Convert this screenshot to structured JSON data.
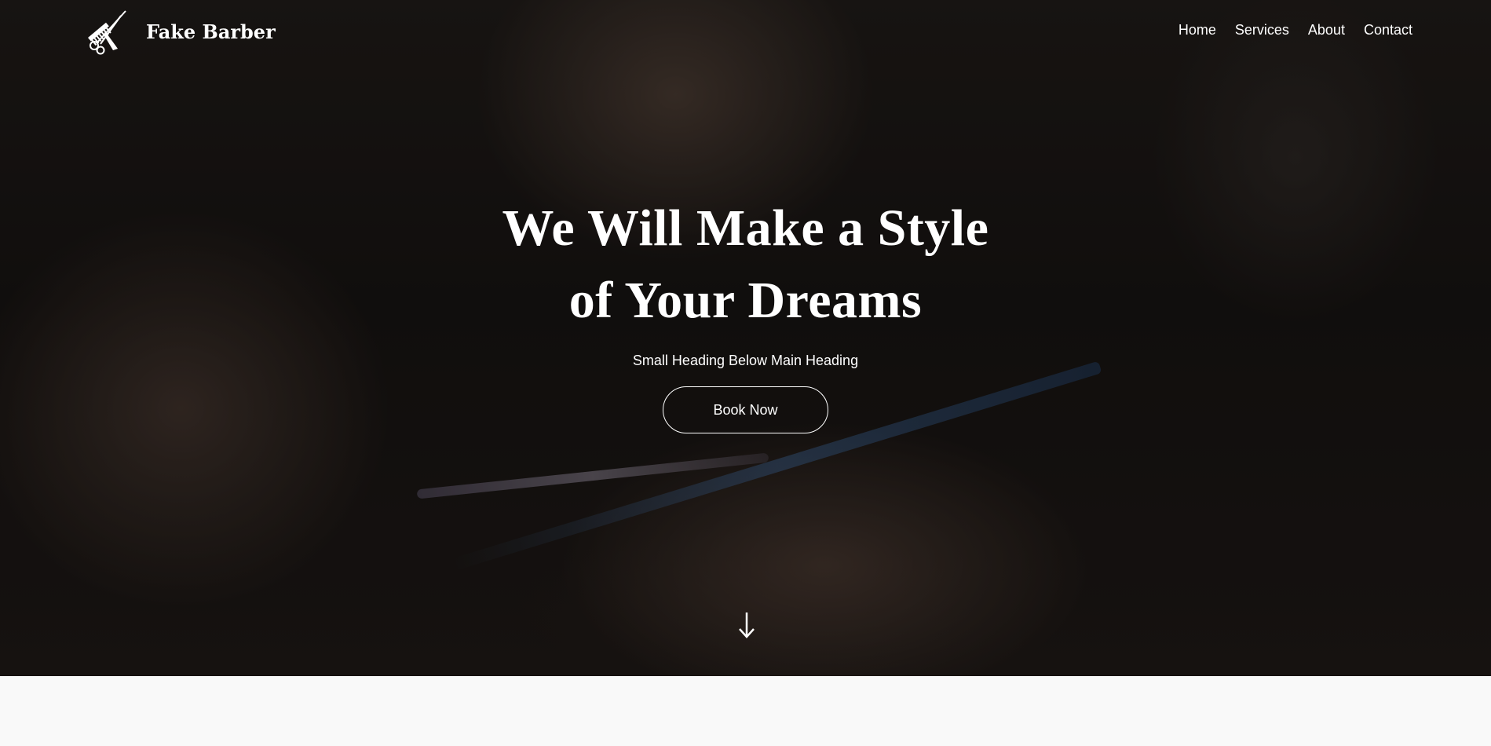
{
  "brand": {
    "name": "Fake Barber",
    "logo_icon": "comb-scissors-icon"
  },
  "nav": {
    "items": [
      "Home",
      "Services",
      "About",
      "Contact"
    ]
  },
  "hero": {
    "title_line1": "We Will Make a Style",
    "title_line2": "of Your Dreams",
    "subtitle": "Small Heading Below Main Heading",
    "button_label": "Book Now",
    "scroll_icon": "arrow-down-icon"
  },
  "colors": {
    "text": "#ffffff",
    "hero_overlay": "#1c1816",
    "section_background": "#f9f9f9"
  }
}
